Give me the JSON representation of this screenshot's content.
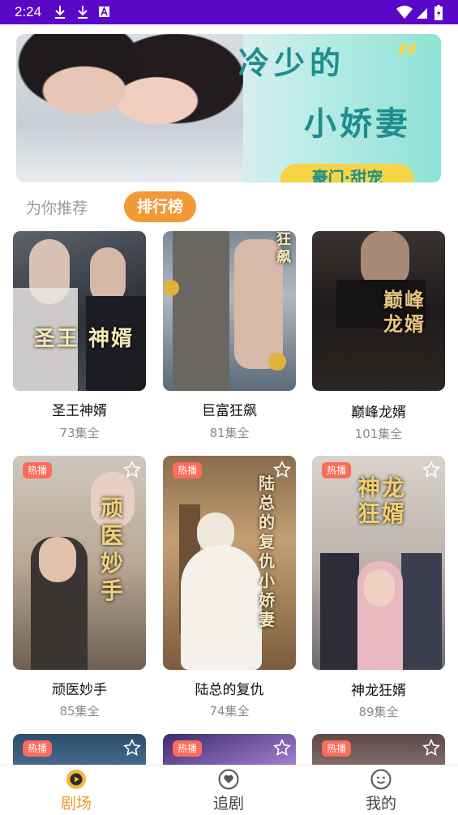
{
  "status_bar": {
    "time": "2:24"
  },
  "banner": {
    "title_line1": "冷少的",
    "title_line2": "小娇妻",
    "tag": "豪门·甜宠",
    "accent": "#1f8d8e"
  },
  "tabs": {
    "recommend": "为你推荐",
    "ranking": "排行榜",
    "active_color": "#f19a36"
  },
  "dramas": [
    {
      "name": "圣王神婿",
      "episodes": "73集全",
      "poster_text": "圣王 神婿"
    },
    {
      "name": "巨富狂飙",
      "episodes": "81集全",
      "poster_text": "狂飙"
    },
    {
      "name": "巅峰龙婿",
      "episodes": "101集全",
      "poster_text": "巅峰龙婿"
    },
    {
      "name": "顽医妙手",
      "episodes": "85集全",
      "badge": "热播",
      "poster_text": "顽医妙手"
    },
    {
      "name": "陆总的复仇",
      "episodes": "74集全",
      "badge": "热播",
      "poster_text": "陆总的复仇小娇妻"
    },
    {
      "name": "神龙狂婿",
      "episodes": "89集全",
      "badge": "热播",
      "poster_text": "神龙狂婿"
    },
    {
      "badge": "热播"
    },
    {
      "badge": "热播"
    },
    {
      "badge": "热播"
    }
  ],
  "bottom_nav": {
    "items": [
      {
        "label": "剧场",
        "icon": "theater-icon"
      },
      {
        "label": "追剧",
        "icon": "heart-icon"
      },
      {
        "label": "我的",
        "icon": "smiley-icon"
      }
    ],
    "active_color": "#f09a30"
  }
}
